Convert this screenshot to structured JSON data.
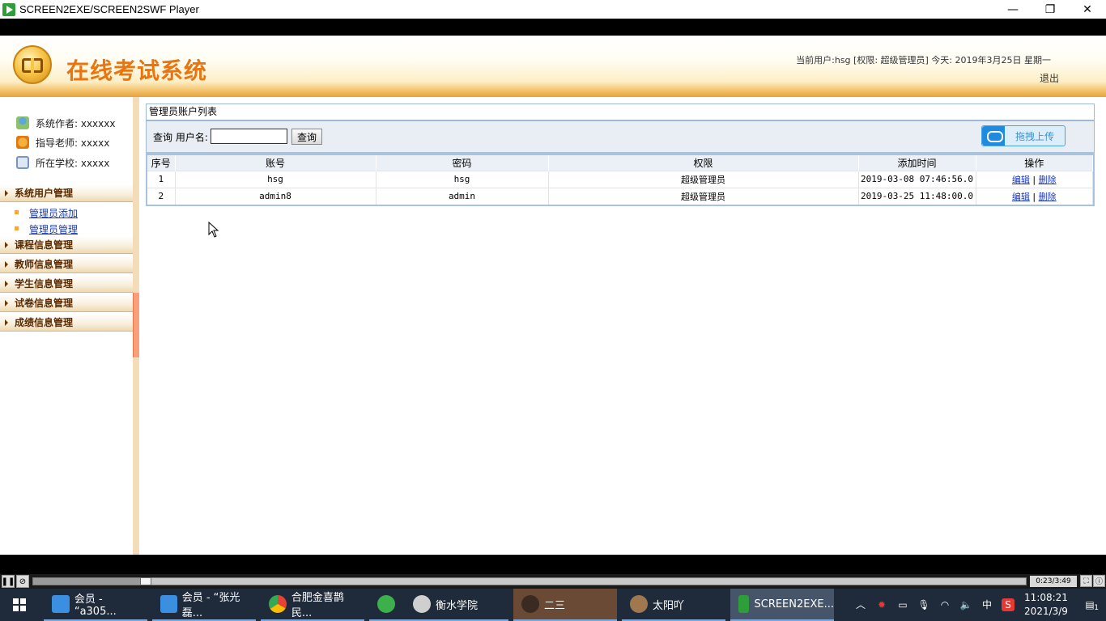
{
  "window": {
    "title": "SCREEN2EXE/SCREEN2SWF Player",
    "minimize": "—",
    "restore": "❐",
    "close": "✕"
  },
  "header": {
    "system_title": "在线考试系统",
    "user_info": "当前用户:hsg [权限: 超级管理员] 今天: 2019年3月25日 星期一",
    "logout": "退出"
  },
  "sidebar": {
    "info": [
      {
        "label": "系统作者: xxxxxx",
        "icon": "author-icon"
      },
      {
        "label": "指导老师: xxxxx",
        "icon": "teacher-icon"
      },
      {
        "label": "所在学校: xxxxx",
        "icon": "school-icon"
      }
    ],
    "groups": [
      {
        "label": "系统用户管理",
        "items": [
          "管理员添加",
          "管理员管理"
        ]
      },
      {
        "label": "课程信息管理"
      },
      {
        "label": "教师信息管理"
      },
      {
        "label": "学生信息管理"
      },
      {
        "label": "试卷信息管理"
      },
      {
        "label": "成绩信息管理"
      }
    ]
  },
  "main": {
    "panel_title": "管理员账户列表",
    "search": {
      "label": "查询 用户名:",
      "value": "",
      "button": "查询"
    },
    "upload_button": "拖拽上传",
    "table": {
      "headers": [
        "序号",
        "账号",
        "密码",
        "权限",
        "添加时间",
        "操作"
      ],
      "rows": [
        {
          "no": "1",
          "account": "hsg",
          "password": "hsg",
          "role": "超级管理员",
          "time": "2019-03-08 07:46:56.0",
          "edit": "编辑",
          "sep": "|",
          "delete": "删除"
        },
        {
          "no": "2",
          "account": "admin8",
          "password": "admin",
          "role": "超级管理员",
          "time": "2019-03-25 11:48:00.0",
          "edit": "编辑",
          "sep": "|",
          "delete": "删除"
        }
      ]
    }
  },
  "player": {
    "time": "0:23/3:49",
    "progress": 0.108
  },
  "taskbar": {
    "tasks": [
      {
        "label": "会员 - “a305...",
        "icon": "box-app-icon"
      },
      {
        "label": "会员 - “张光磊...",
        "icon": "box-app-icon"
      },
      {
        "label": "合肥金喜鹊民...",
        "icon": "chrome-icon"
      },
      {
        "label": "",
        "icon": "green-app-icon"
      },
      {
        "label": "衡水学院",
        "icon": "avatar-icon"
      },
      {
        "label": "二三",
        "icon": "avatar-icon"
      },
      {
        "label": "太阳吖",
        "icon": "avatar-icon"
      },
      {
        "label": "SCREEN2EXE...",
        "icon": "screen2exe-icon"
      }
    ],
    "tray": {
      "ime": "中",
      "time": "11:08:21",
      "date": "2021/3/9",
      "notifications": "1"
    }
  },
  "colors": {
    "title_orange": "#e8750f",
    "link_blue": "#1a3bb8",
    "taskbar": "#1f2b3a"
  }
}
